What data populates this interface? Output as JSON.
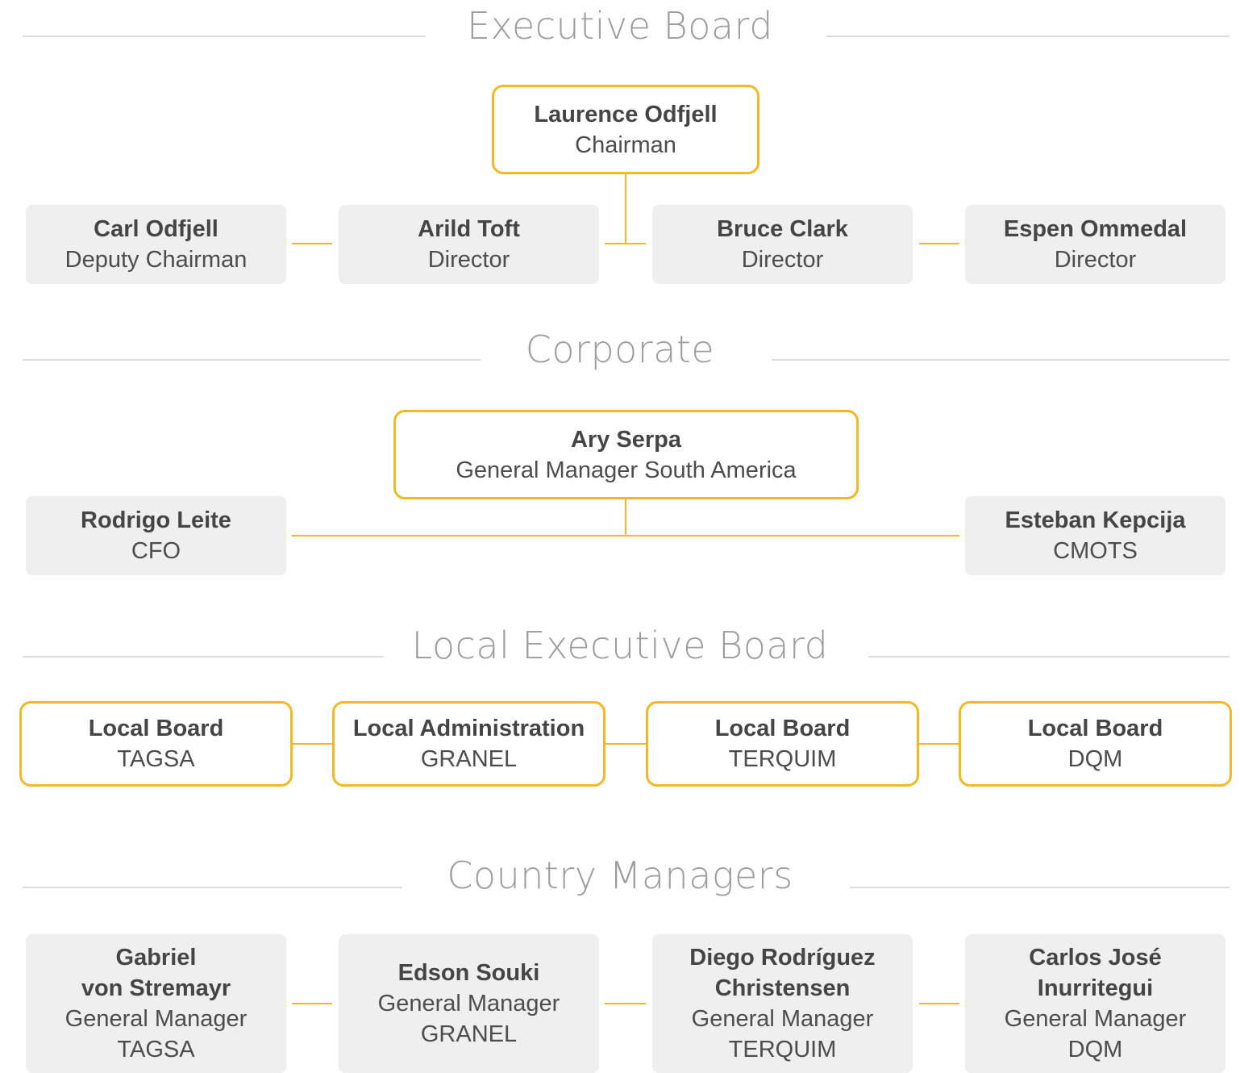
{
  "sections": {
    "executive_board": {
      "title": "Executive Board",
      "chairman": {
        "name": "Laurence Odfjell",
        "role": "Chairman"
      },
      "members": [
        {
          "name": "Carl Odfjell",
          "role": "Deputy Chairman"
        },
        {
          "name": "Arild Toft",
          "role": "Director"
        },
        {
          "name": "Bruce Clark",
          "role": "Director"
        },
        {
          "name": "Espen Ommedal",
          "role": "Director"
        }
      ]
    },
    "corporate": {
      "title": "Corporate",
      "head": {
        "name": "Ary Serpa",
        "role": "General Manager South America"
      },
      "members": [
        {
          "name": "Rodrigo Leite",
          "role": "CFO"
        },
        {
          "name": "Esteban Kepcija",
          "role": "CMOTS"
        }
      ]
    },
    "local_executive_board": {
      "title": "Local Executive Board",
      "boards": [
        {
          "name": "Local Board",
          "role": "TAGSA"
        },
        {
          "name": "Local Administration",
          "role": "GRANEL"
        },
        {
          "name": "Local Board",
          "role": "TERQUIM"
        },
        {
          "name": "Local Board",
          "role": "DQM"
        }
      ]
    },
    "country_managers": {
      "title": "Country Managers",
      "managers": [
        {
          "name_line1": "Gabriel",
          "name_line2": "von Stremayr",
          "role": "General Manager",
          "company": "TAGSA"
        },
        {
          "name_line1": "Edson Souki",
          "role": "General Manager",
          "company": "GRANEL"
        },
        {
          "name_line1": "Diego Rodríguez",
          "name_line2": "Christensen",
          "role": "General Manager",
          "company": "TERQUIM"
        },
        {
          "name_line1": "Carlos José",
          "name_line2": "Inurritegui",
          "role": "General Manager",
          "company": "DQM"
        }
      ]
    }
  },
  "colors": {
    "accent": "#f3b824",
    "box_fill": "#efefef",
    "rule": "#dcdcdc",
    "section_title": "#9d9d9d"
  }
}
